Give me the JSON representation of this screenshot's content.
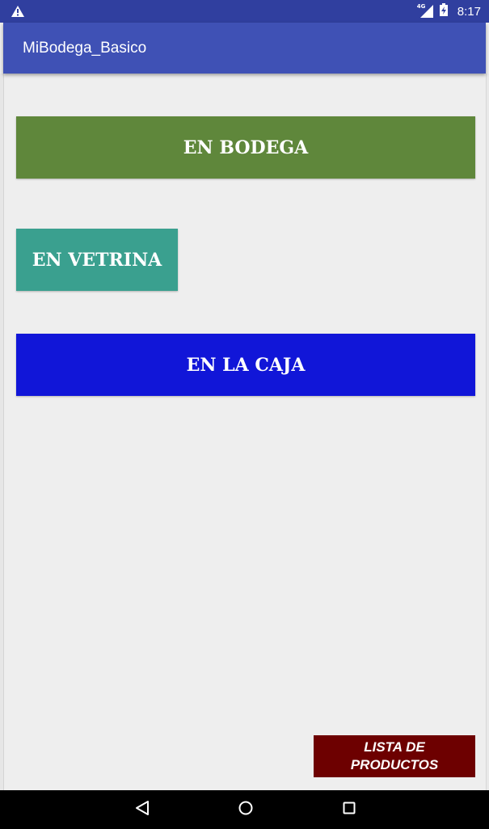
{
  "status_bar": {
    "network_type": "4G",
    "time": "8:17",
    "icons": [
      "warning-icon",
      "signal-icon",
      "battery-icon"
    ]
  },
  "app_bar": {
    "title": "MiBodega_Basico"
  },
  "buttons": {
    "en_bodega": "EN BODEGA",
    "en_vetrina": "EN VETRINA",
    "en_la_caja": "EN LA CAJA",
    "lista_line1": "LISTA DE",
    "lista_line2": "PRODUCTOS"
  },
  "nav_bar": {
    "icons": [
      "back-icon",
      "home-icon",
      "recents-icon"
    ]
  },
  "colors": {
    "status_bar": "#303f9f",
    "app_bar": "#3f51b5",
    "background": "#eeeeee",
    "en_bodega": "#5f873b",
    "en_vetrina": "#3aa08f",
    "en_la_caja": "#1116d8",
    "lista_productos": "#6d0000",
    "nav_bar": "#000000"
  }
}
